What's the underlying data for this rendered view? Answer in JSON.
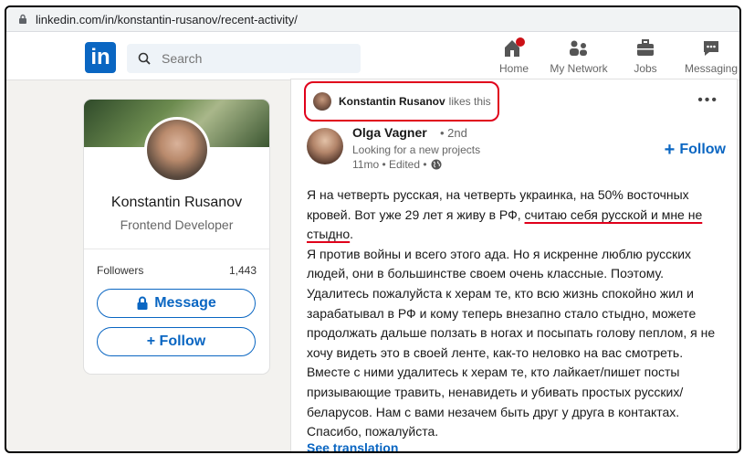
{
  "browser": {
    "url": "linkedin.com/in/konstantin-rusanov/recent-activity/"
  },
  "nav": {
    "logo": "in",
    "search_placeholder": "Search",
    "items": [
      {
        "label": "Home",
        "icon": "home-icon"
      },
      {
        "label": "My Network",
        "icon": "network-icon"
      },
      {
        "label": "Jobs",
        "icon": "briefcase-icon"
      },
      {
        "label": "Messaging",
        "icon": "messaging-icon"
      }
    ]
  },
  "profile": {
    "name": "Konstantin Rusanov",
    "role": "Frontend Developer",
    "followers_label": "Followers",
    "followers_count": "1,443",
    "message_label": "Message",
    "follow_label": "+ Follow"
  },
  "feed": {
    "liker_name": "Konstantin Rusanov",
    "liker_suffix": "likes this",
    "more": "•••",
    "author": {
      "name": "Olga Vagner",
      "degree": "• 2nd",
      "headline": "Looking for a new projects",
      "meta": "11mo • Edited •"
    },
    "follow_label": "Follow",
    "post_p1_start": "Я на четверть русская, на четверть украинка, на 50% восточных кровей. Вот уже 29 лет я живу в РФ, ",
    "post_p1_underlined": "считаю себя русской и мне не стыдно",
    "post_p1_end": ".",
    "post_p2": "Я против войны и всего этого ада. Но я искренне люблю русских людей, они в большинстве своем очень классные. Поэтому. Удалитесь пожалуйста к херам те, кто всю жизнь спокойно жил и зарабатывал в РФ и кому теперь внезапно стало стыдно, можете продолжать дальше ползать в ногах и посыпать голову пеплом, я не хочу видеть это в своей ленте, как-то неловко на вас смотреть. Вместе с ними удалитесь к херам те, кто лайкает/пишет посты призывающие травить, ненавидеть и убивать простых русских/беларусов. Нам с вами незачем быть друг у друга в контактах. Спасибо, пожалуйста.",
    "see_translation": "See translation"
  },
  "colors": {
    "brand": "#0a66c2",
    "annotation_red": "#e0001b"
  }
}
